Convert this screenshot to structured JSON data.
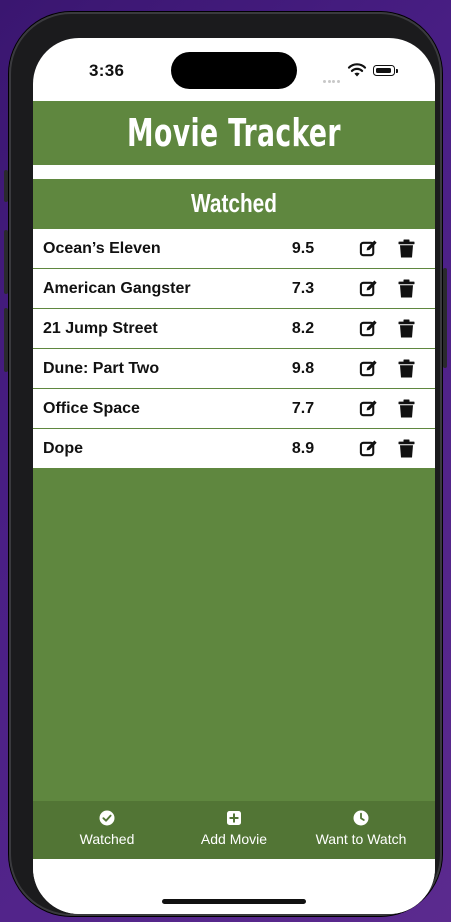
{
  "status_bar": {
    "time": "3:36"
  },
  "app": {
    "title": "Movie Tracker"
  },
  "section": {
    "title": "Watched"
  },
  "movies": [
    {
      "title": "Ocean’s Eleven",
      "rating": "9.5"
    },
    {
      "title": "American Gangster",
      "rating": "7.3"
    },
    {
      "title": "21 Jump Street",
      "rating": "8.2"
    },
    {
      "title": "Dune: Part Two",
      "rating": "9.8"
    },
    {
      "title": "Office Space",
      "rating": "7.7"
    },
    {
      "title": "Dope",
      "rating": "8.9"
    }
  ],
  "tabs": [
    {
      "label": "Watched",
      "icon": "check-circle-icon"
    },
    {
      "label": "Add Movie",
      "icon": "plus-square-icon"
    },
    {
      "label": "Want to Watch",
      "icon": "clock-icon"
    }
  ],
  "colors": {
    "header_green": "#5f873f",
    "tab_bar_green": "#527535",
    "row_background": "#ffffff",
    "text_dark": "#111111"
  }
}
